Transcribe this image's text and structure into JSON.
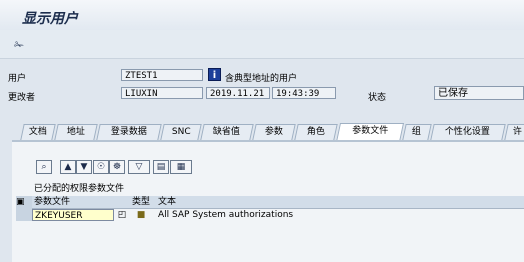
{
  "header": {
    "title": "显示用户"
  },
  "toolbar": {
    "display_change_icon": "glasses-icon"
  },
  "form": {
    "user_label": "用户",
    "user_value": "ZTEST1",
    "user_desc": "含典型地址的用户",
    "changed_by_label": "更改者",
    "changed_by_value": "LIUXIN",
    "date_value": "2019.11.21",
    "time_value": "19:43:39",
    "status_label": "状态",
    "status_value": "已保存"
  },
  "tabs": [
    {
      "label": "文档"
    },
    {
      "label": "地址"
    },
    {
      "label": "登录数据"
    },
    {
      "label": "SNC"
    },
    {
      "label": "缺省值"
    },
    {
      "label": "参数"
    },
    {
      "label": "角色"
    },
    {
      "label": "参数文件",
      "active": true
    },
    {
      "label": "组"
    },
    {
      "label": "个性化设置"
    },
    {
      "label": "许"
    }
  ],
  "profiles": {
    "section_title": "已分配的权限参数文件",
    "columns": {
      "profile": "参数文件",
      "type": "类型",
      "text": "文本"
    },
    "rows": [
      {
        "profile": "ZKEYUSER",
        "text": "All SAP System authorizations"
      }
    ]
  }
}
